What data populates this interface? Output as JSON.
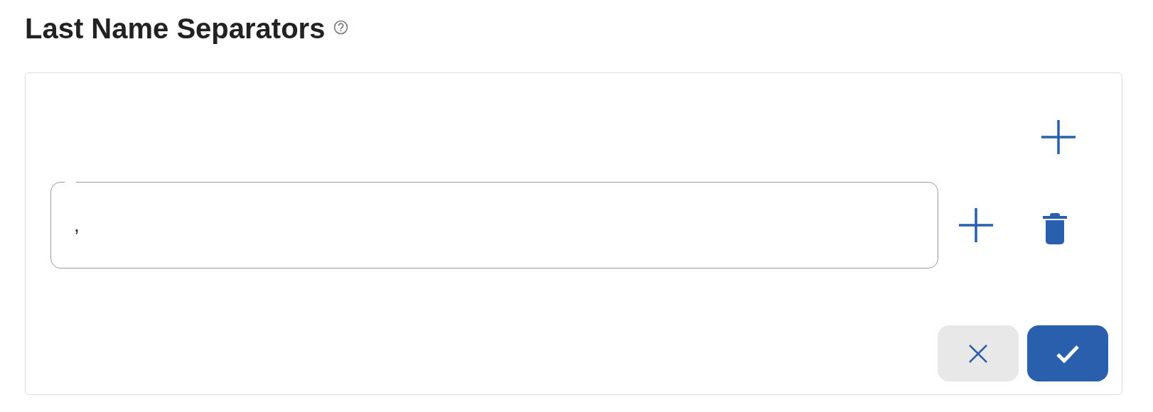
{
  "title": "Last Name Separators",
  "separators": [
    {
      "value": ","
    }
  ]
}
